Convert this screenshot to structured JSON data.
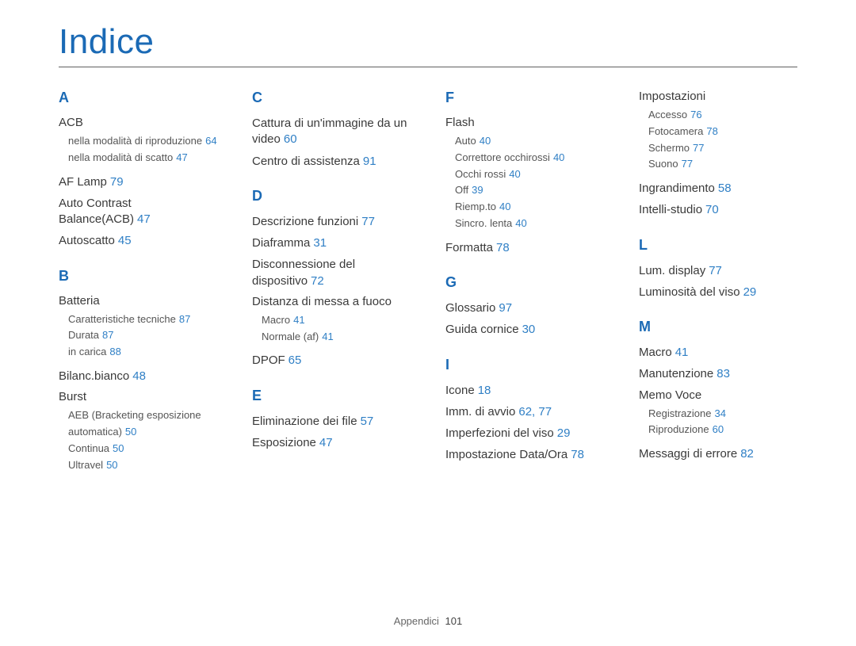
{
  "page": {
    "title": "Indice",
    "footer_label": "Appendici",
    "footer_page": "101"
  },
  "col1": {
    "A": "A",
    "acb_h": "ACB",
    "acb_s1_t": "nella modalità di riproduzione",
    "acb_s1_p": "64",
    "acb_s2_t": "nella modalità di scatto",
    "acb_s2_p": "47",
    "aflamp_t": "AF Lamp",
    "aflamp_p": "79",
    "autocb_t": "Auto Contrast Balance(ACB)",
    "autocb_p": "47",
    "autos_t": "Autoscatto",
    "autos_p": "45",
    "B": "B",
    "batt_h": "Batteria",
    "batt_s1_t": "Caratteristiche tecniche",
    "batt_s1_p": "87",
    "batt_s2_t": "Durata",
    "batt_s2_p": "87",
    "batt_s3_t": "in carica",
    "batt_s3_p": "88",
    "bilanc_t": "Bilanc.bianco",
    "bilanc_p": "48",
    "burst_h": "Burst",
    "burst_s1_t": "AEB (Bracketing esposizione automatica)",
    "burst_s1_p": "50",
    "burst_s2_t": "Continua",
    "burst_s2_p": "50",
    "burst_s3_t": "Ultravel",
    "burst_s3_p": "50"
  },
  "col2": {
    "C": "C",
    "catt_t": "Cattura di un'immagine da un video",
    "catt_p": "60",
    "centro_t": "Centro di assistenza",
    "centro_p": "91",
    "D": "D",
    "desc_t": "Descrizione funzioni",
    "desc_p": "77",
    "diaf_t": "Diaframma",
    "diaf_p": "31",
    "disc_t": "Disconnessione del dispositivo",
    "disc_p": "72",
    "dist_h": "Distanza di messa a fuoco",
    "dist_s1_t": "Macro",
    "dist_s1_p": "41",
    "dist_s2_t": "Normale (af)",
    "dist_s2_p": "41",
    "dpof_t": "DPOF",
    "dpof_p": "65",
    "E": "E",
    "elim_t": "Eliminazione dei file",
    "elim_p": "57",
    "esp_t": "Esposizione",
    "esp_p": "47"
  },
  "col3": {
    "F": "F",
    "flash_h": "Flash",
    "f_s1_t": "Auto",
    "f_s1_p": "40",
    "f_s2_t": "Correttore occhirossi",
    "f_s2_p": "40",
    "f_s3_t": "Occhi rossi",
    "f_s3_p": "40",
    "f_s4_t": "Off",
    "f_s4_p": "39",
    "f_s5_t": "Riemp.to",
    "f_s5_p": "40",
    "f_s6_t": "Sincro. lenta",
    "f_s6_p": "40",
    "form_t": "Formatta",
    "form_p": "78",
    "G": "G",
    "glos_t": "Glossario",
    "glos_p": "97",
    "guida_t": "Guida cornice",
    "guida_p": "30",
    "I": "I",
    "icone_t": "Icone",
    "icone_p": "18",
    "imma_t": "Imm. di avvio",
    "imma_p": "62, 77",
    "imperf_t": "Imperfezioni del viso",
    "imperf_p": "29",
    "impdo_t": "Impostazione Data/Ora",
    "impdo_p": "78"
  },
  "col4": {
    "imp_h": "Impostazioni",
    "imp_s1_t": "Accesso",
    "imp_s1_p": "76",
    "imp_s2_t": "Fotocamera",
    "imp_s2_p": "78",
    "imp_s3_t": "Schermo",
    "imp_s3_p": "77",
    "imp_s4_t": "Suono",
    "imp_s4_p": "77",
    "ingr_t": "Ingrandimento",
    "ingr_p": "58",
    "intelli_t": "Intelli-studio",
    "intelli_p": "70",
    "L": "L",
    "lumd_t": "Lum. display",
    "lumd_p": "77",
    "lumv_t": "Luminosità del viso",
    "lumv_p": "29",
    "M": "M",
    "macro_t": "Macro",
    "macro_p": "41",
    "manut_t": "Manutenzione",
    "manut_p": "83",
    "memo_h": "Memo Voce",
    "memo_s1_t": "Registrazione",
    "memo_s1_p": "34",
    "memo_s2_t": "Riproduzione",
    "memo_s2_p": "60",
    "mess_t": "Messaggi di errore",
    "mess_p": "82"
  }
}
